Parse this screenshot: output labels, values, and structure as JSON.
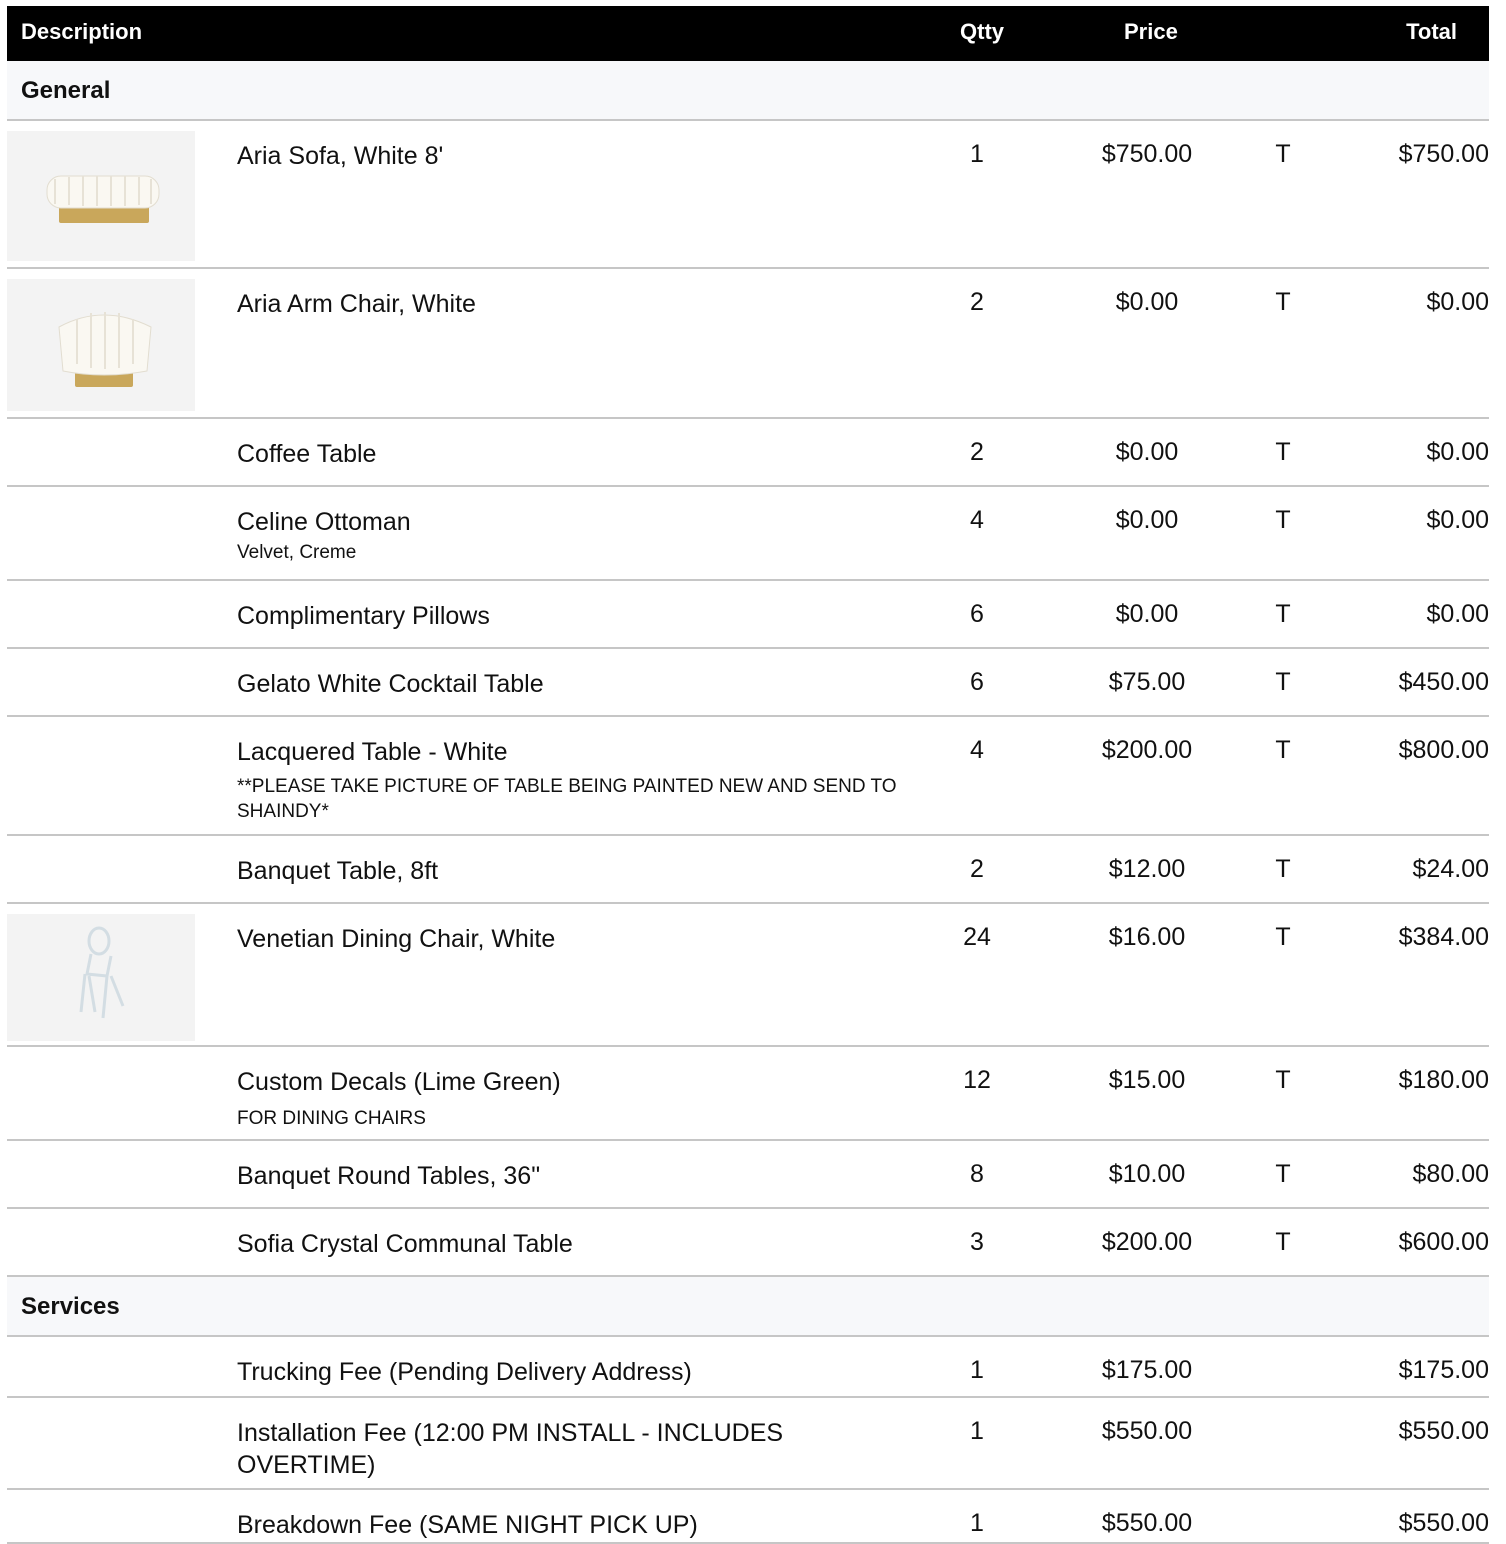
{
  "headers": {
    "description": "Description",
    "qty": "Qtty",
    "price": "Price",
    "total": "Total"
  },
  "sections": [
    {
      "name": "General",
      "rows": [
        {
          "desc": "Aria Sofa, White 8'",
          "qty": "1",
          "price": "$750.00",
          "tax": "T",
          "total": "$750.00",
          "image": "sofa"
        },
        {
          "desc": "Aria Arm Chair, White",
          "qty": "2",
          "price": "$0.00",
          "tax": "T",
          "total": "$0.00",
          "image": "armchair"
        },
        {
          "desc": "Coffee Table",
          "qty": "2",
          "price": "$0.00",
          "tax": "T",
          "total": "$0.00"
        },
        {
          "desc": "Celine Ottoman",
          "note": "Velvet, Creme",
          "qty": "4",
          "price": "$0.00",
          "tax": "T",
          "total": "$0.00"
        },
        {
          "desc": "Complimentary Pillows",
          "qty": "6",
          "price": "$0.00",
          "tax": "T",
          "total": "$0.00"
        },
        {
          "desc": "Gelato White Cocktail Table",
          "qty": "6",
          "price": "$75.00",
          "tax": "T",
          "total": "$450.00"
        },
        {
          "desc": "Lacquered Table - White",
          "note": "**PLEASE TAKE PICTURE OF TABLE BEING PAINTED NEW AND SEND TO SHAINDY*",
          "qty": "4",
          "price": "$200.00",
          "tax": "T",
          "total": "$800.00"
        },
        {
          "desc": "Banquet Table, 8ft",
          "qty": "2",
          "price": "$12.00",
          "tax": "T",
          "total": "$24.00"
        },
        {
          "desc": "Venetian Dining Chair, White",
          "qty": "24",
          "price": "$16.00",
          "tax": "T",
          "total": "$384.00",
          "image": "dining-chair"
        },
        {
          "desc": "Custom Decals (Lime Green)",
          "note": "FOR DINING CHAIRS",
          "qty": "12",
          "price": "$15.00",
          "tax": "T",
          "total": "$180.00"
        },
        {
          "desc": "Banquet Round Tables, 36\"",
          "qty": "8",
          "price": "$10.00",
          "tax": "T",
          "total": "$80.00"
        },
        {
          "desc": "Sofia Crystal Communal Table",
          "qty": "3",
          "price": "$200.00",
          "tax": "T",
          "total": "$600.00"
        }
      ]
    },
    {
      "name": "Services",
      "rows": [
        {
          "desc": "Trucking Fee (Pending Delivery Address)",
          "qty": "1",
          "price": "$175.00",
          "tax": "",
          "total": "$175.00"
        },
        {
          "desc": "Installation Fee (12:00 PM INSTALL - INCLUDES OVERTIME)",
          "qty": "1",
          "price": "$550.00",
          "tax": "",
          "total": "$550.00"
        },
        {
          "desc": "Breakdown Fee (SAME NIGHT PICK UP)",
          "qty": "1",
          "price": "$550.00",
          "tax": "",
          "total": "$550.00"
        }
      ]
    }
  ]
}
